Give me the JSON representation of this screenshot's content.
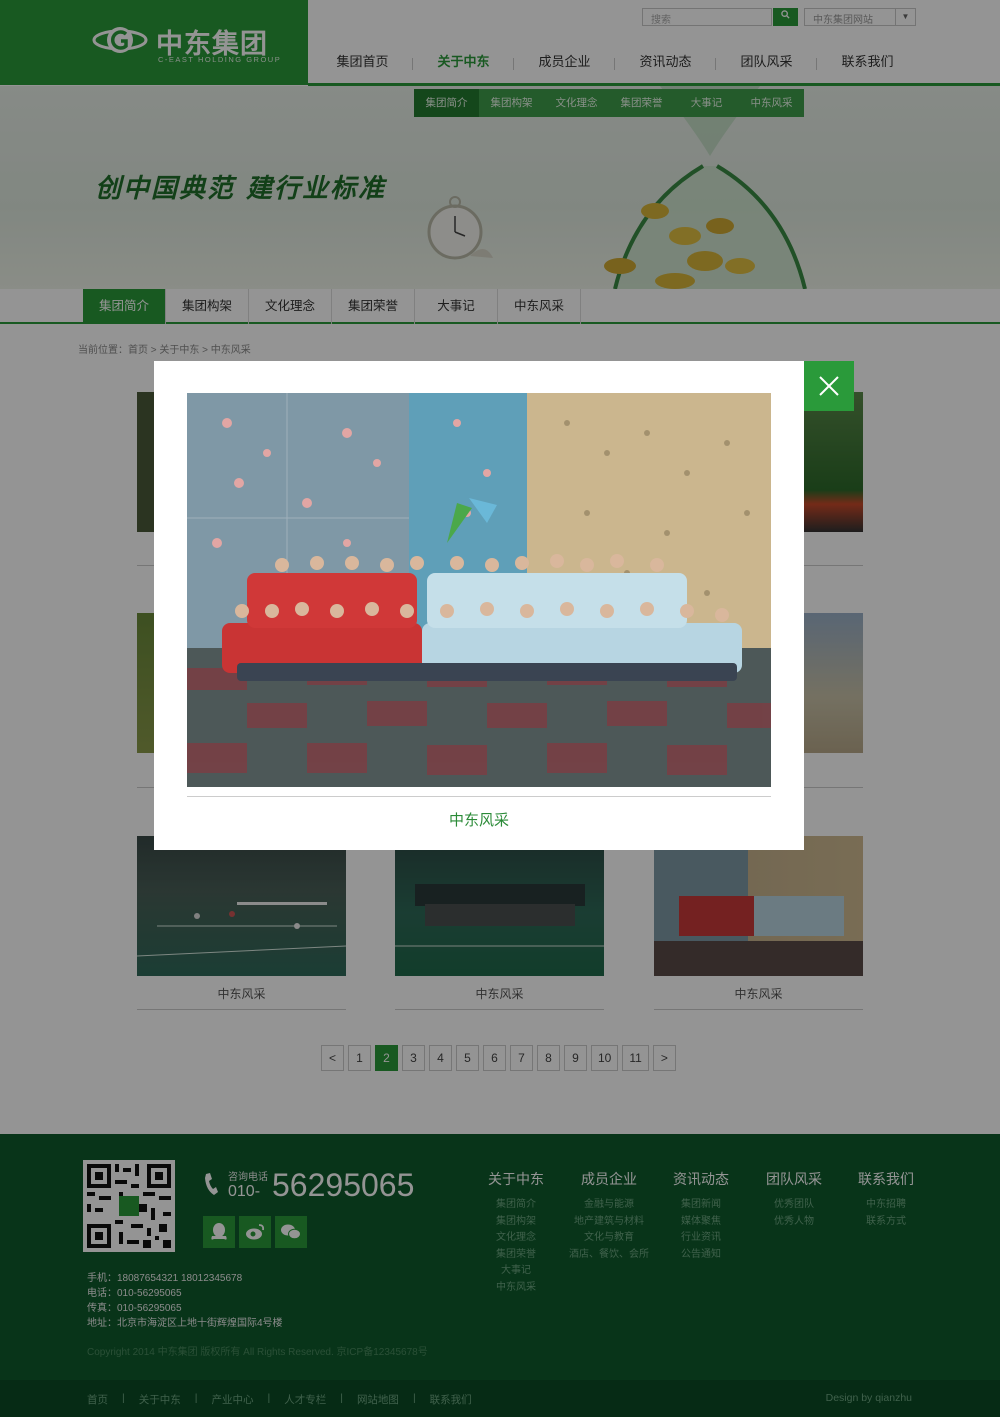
{
  "header": {
    "logo_cn": "中东集团",
    "logo_en": "C-EAST HOLDING GROUP",
    "search_placeholder": "搜索",
    "search_icon": "search-icon",
    "site_select": "中东集团网站",
    "nav": [
      "集团首页",
      "关于中东",
      "成员企业",
      "资讯动态",
      "团队风采",
      "联系我们"
    ],
    "active_nav": "关于中东"
  },
  "banner": {
    "slogan": "创中国典范  建行业标准",
    "subnav": [
      "集团简介",
      "集团构架",
      "文化理念",
      "集团荣誉",
      "大事记",
      "中东风采"
    ]
  },
  "tabs": [
    "集团简介",
    "集团构架",
    "文化理念",
    "集团荣誉",
    "大事记",
    "中东风采"
  ],
  "breadcrumb": "当前位置：首页 > 关于中东 > 中东风采",
  "gallery": {
    "captions": [
      "中东风采",
      "中东风采",
      "中东风采"
    ]
  },
  "pagination": {
    "prev": "<",
    "pages": [
      "1",
      "2",
      "3",
      "4",
      "5",
      "6",
      "7",
      "8",
      "9",
      "10",
      "11"
    ],
    "current": "2",
    "next": ">"
  },
  "modal": {
    "caption": "中东风采",
    "close_icon": "close-icon"
  },
  "footer": {
    "phone_label": "咨询电话",
    "phone_area": "010-",
    "phone_number": "56295065",
    "contacts": [
      "手机：18087654321  18012345678",
      "电话：010-56295065",
      "传真：010-56295065",
      "地址：北京市海淀区上地十街辉煌国际4号楼"
    ],
    "copyright": "Copyright 2014 中东集团 版权所有 All Rights Reserved.   京ICP备12345678号",
    "columns": [
      {
        "title": "关于中东",
        "links": [
          "集团简介",
          "集团构架",
          "文化理念",
          "集团荣誉",
          "大事记",
          "中东风采"
        ]
      },
      {
        "title": "成员企业",
        "links": [
          "金融与能源",
          "地产建筑与材料",
          "文化与教育",
          "酒店、餐饮、会所"
        ]
      },
      {
        "title": "资讯动态",
        "links": [
          "集团新闻",
          "媒体聚焦",
          "行业资讯",
          "公告通知"
        ]
      },
      {
        "title": "团队风采",
        "links": [
          "优秀团队",
          "优秀人物"
        ]
      },
      {
        "title": "联系我们",
        "links": [
          "中东招聘",
          "联系方式"
        ]
      }
    ],
    "bottom_links": [
      "首页",
      "关于中东",
      "产业中心",
      "人才专栏",
      "网站地图",
      "联系我们"
    ],
    "design": "Design by qianzhu",
    "social_icons": [
      "qq-icon",
      "weibo-icon",
      "wechat-icon"
    ]
  },
  "colors": {
    "brand_green": "#2a9a3a",
    "footer_green": "#0e5a2c"
  }
}
